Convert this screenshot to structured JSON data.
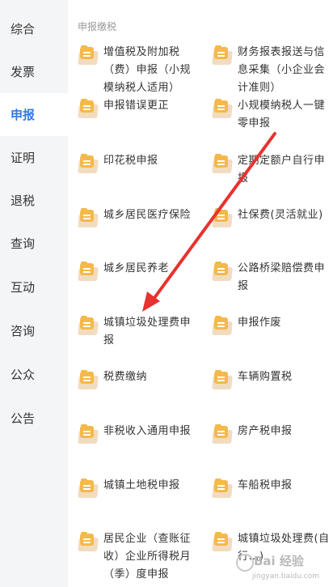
{
  "sidebar": {
    "items": [
      {
        "label": "综合"
      },
      {
        "label": "发票"
      },
      {
        "label": "申报"
      },
      {
        "label": "证明"
      },
      {
        "label": "退税"
      },
      {
        "label": "查询"
      },
      {
        "label": "互动"
      },
      {
        "label": "咨询"
      },
      {
        "label": "公众"
      },
      {
        "label": "公告"
      }
    ],
    "active": "申报"
  },
  "section": {
    "title": "申报缴税"
  },
  "items": [
    {
      "label": "增值税及附加税（费）申报（小规模纳税人适用）"
    },
    {
      "label": "财务报表报送与信息采集（小企业会计准则）"
    },
    {
      "label": "申报错误更正"
    },
    {
      "label": "小规模纳税人一键零申报"
    },
    {
      "label": "印花税申报"
    },
    {
      "label": "定期定额户自行申报"
    },
    {
      "label": "城乡居民医疗保险"
    },
    {
      "label": "社保费(灵活就业)"
    },
    {
      "label": "城乡居民养老"
    },
    {
      "label": "公路桥梁赔偿费申报"
    },
    {
      "label": "城镇垃圾处理费申报"
    },
    {
      "label": "申报作废"
    },
    {
      "label": "税费缴纳"
    },
    {
      "label": "车辆购置税"
    },
    {
      "label": "非税收入通用申报"
    },
    {
      "label": "房产税申报"
    },
    {
      "label": "城镇土地税申报"
    },
    {
      "label": "车船税申报"
    },
    {
      "label": "居民企业（查账征收）企业所得税月（季）度申报"
    },
    {
      "label": "城镇垃圾处理费(自行…)"
    }
  ],
  "watermark": {
    "main": "Bai 经验",
    "sub": "jingyan.baidu.com"
  },
  "colors": {
    "accent": "#2f7bea",
    "arrow": "#e8322e",
    "icon": "#f5b94a"
  }
}
